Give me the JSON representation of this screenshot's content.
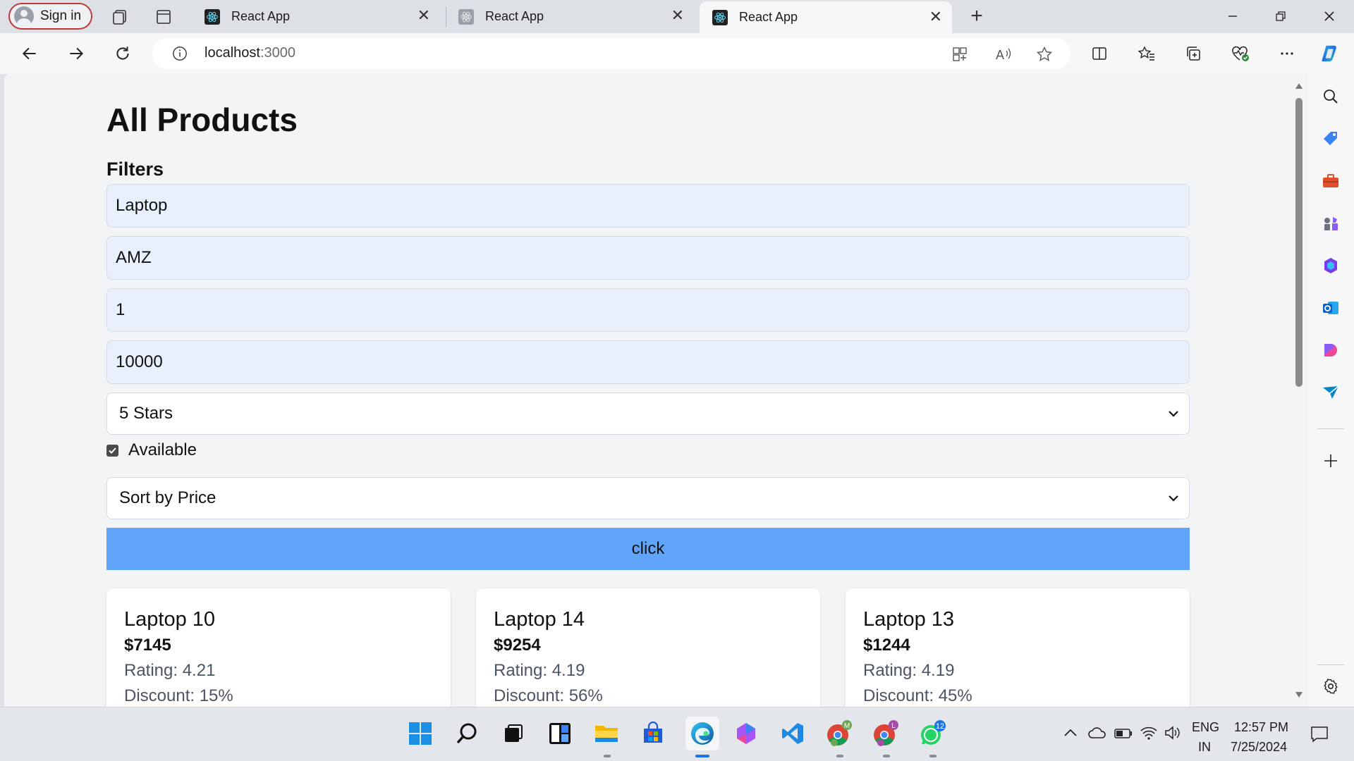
{
  "browser": {
    "profile_label": "Sign in",
    "tabs": [
      {
        "title": "React App"
      },
      {
        "title": "React App"
      },
      {
        "title": "React App"
      }
    ],
    "url_host": "localhost",
    "url_port": ":3000"
  },
  "page": {
    "title": "All Products",
    "filters_label": "Filters",
    "filters": {
      "category": "Laptop",
      "company": "AMZ",
      "min_price": "1",
      "max_price": "10000",
      "rating_select": "5 Stars",
      "available_label": "Available",
      "available_checked": true,
      "sort_select": "Sort by Price"
    },
    "submit_label": "click",
    "products": [
      {
        "name": "Laptop 10",
        "price": "$7145",
        "rating": "Rating: 4.21",
        "discount": "Discount: 15%"
      },
      {
        "name": "Laptop 14",
        "price": "$9254",
        "rating": "Rating: 4.19",
        "discount": "Discount: 56%"
      },
      {
        "name": "Laptop 13",
        "price": "$1244",
        "rating": "Rating: 4.19",
        "discount": "Discount: 45%"
      }
    ]
  },
  "taskbar": {
    "lang_top": "ENG",
    "lang_bottom": "IN",
    "time": "12:57 PM",
    "date": "7/25/2024",
    "whatsapp_badge": "12",
    "chrome_badge_1": "M",
    "chrome_badge_2": "L"
  },
  "colors": {
    "accent_button": "#60a5fa",
    "input_bg": "#e8effd",
    "page_bg": "#f3f4f6"
  }
}
